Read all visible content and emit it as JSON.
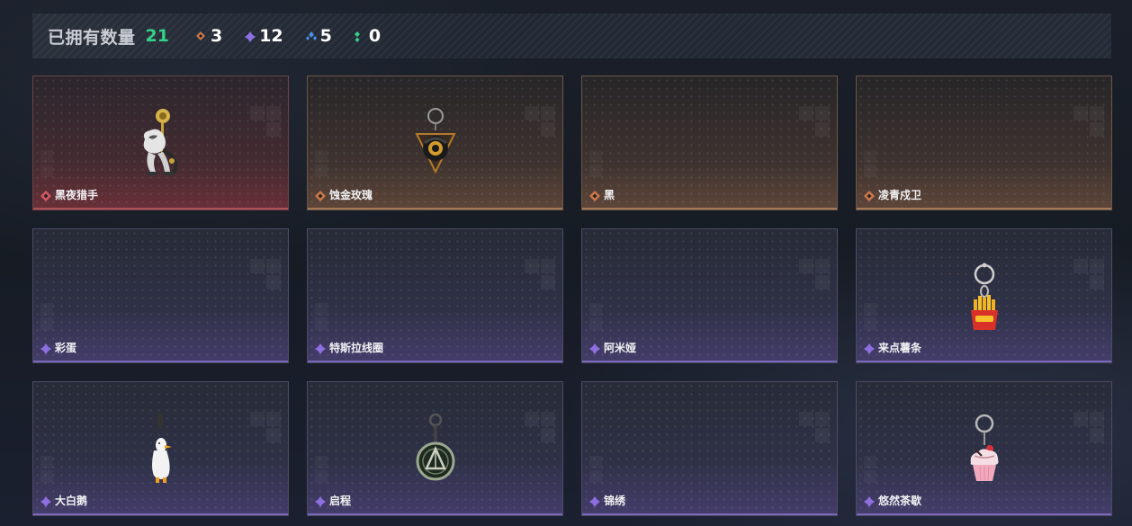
{
  "summary": {
    "title": "已拥有数量",
    "total": "21",
    "counts": [
      {
        "rarity": "orange",
        "color": "#c9784a",
        "value": "3"
      },
      {
        "rarity": "purple",
        "color": "#8d6fe0",
        "value": "12"
      },
      {
        "rarity": "blue",
        "color": "#4a8fe0",
        "value": "5"
      },
      {
        "rarity": "green",
        "color": "#35d08a",
        "value": "0"
      }
    ]
  },
  "colors": {
    "red": "#d25a62",
    "orange": "#c9784a",
    "purple": "#8d6fe0",
    "blue": "#4a8fe0",
    "green": "#35d08a"
  },
  "items": [
    {
      "name": "黑夜猎手",
      "rarity": "red",
      "icon": "night-hunter-charm-icon"
    },
    {
      "name": "蚀金玫瑰",
      "rarity": "orange",
      "icon": "gold-rose-charm-icon"
    },
    {
      "name": "黑",
      "rarity": "orange",
      "icon": ""
    },
    {
      "name": "凌青戍卫",
      "rarity": "orange",
      "icon": ""
    },
    {
      "name": "彩蛋",
      "rarity": "purple",
      "icon": ""
    },
    {
      "name": "特斯拉线圈",
      "rarity": "purple",
      "icon": ""
    },
    {
      "name": "阿米娅",
      "rarity": "purple",
      "icon": ""
    },
    {
      "name": "来点薯条",
      "rarity": "purple",
      "icon": "fries-keychain-icon"
    },
    {
      "name": "大白鹅",
      "rarity": "purple",
      "icon": "white-goose-charm-icon"
    },
    {
      "name": "启程",
      "rarity": "purple",
      "icon": "departure-medallion-icon"
    },
    {
      "name": "锦绣",
      "rarity": "purple",
      "icon": ""
    },
    {
      "name": "悠然茶歇",
      "rarity": "purple",
      "icon": "cupcake-keychain-icon"
    }
  ]
}
